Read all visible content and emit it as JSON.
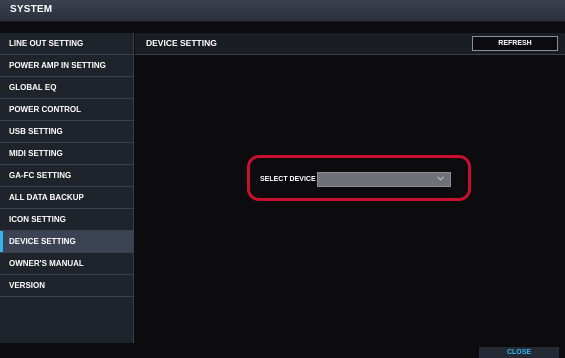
{
  "window": {
    "title": "SYSTEM"
  },
  "sidebar": {
    "items": [
      {
        "label": "LINE OUT SETTING"
      },
      {
        "label": "POWER AMP IN SETTING"
      },
      {
        "label": "GLOBAL EQ"
      },
      {
        "label": "POWER CONTROL"
      },
      {
        "label": "USB SETTING"
      },
      {
        "label": "MIDI SETTING"
      },
      {
        "label": "GA-FC SETTING"
      },
      {
        "label": "ALL DATA BACKUP"
      },
      {
        "label": "ICON SETTING"
      },
      {
        "label": "DEVICE SETTING",
        "active": true
      },
      {
        "label": "OWNER'S MANUAL"
      },
      {
        "label": "VERSION"
      }
    ]
  },
  "main": {
    "title": "DEVICE SETTING",
    "refresh_label": "REFRESH",
    "select_device": {
      "label": "SELECT DEVICE",
      "value": ""
    }
  },
  "footer": {
    "close_label": "CLOSE"
  },
  "colors": {
    "accent": "#35b4ec",
    "highlight": "#c8102e",
    "sidebar_bg": "#1f232c",
    "active_bg": "#3b4254"
  },
  "icons": {
    "select_arrow": "chevron-down-icon"
  }
}
